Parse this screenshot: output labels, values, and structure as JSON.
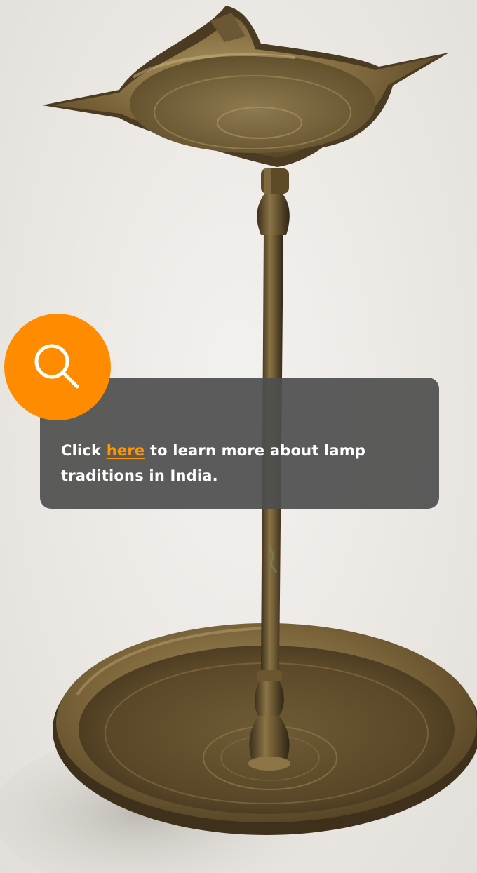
{
  "info_card": {
    "text_before": "Click ",
    "link_text": "here",
    "text_after": " to learn more about lamp traditions in India."
  },
  "colors": {
    "accent": "#FF8C00",
    "link": "#FF9500",
    "card_background": "#4E4E4E",
    "text": "#FFFFFF"
  },
  "icons": {
    "badge_icon": "search-icon"
  }
}
